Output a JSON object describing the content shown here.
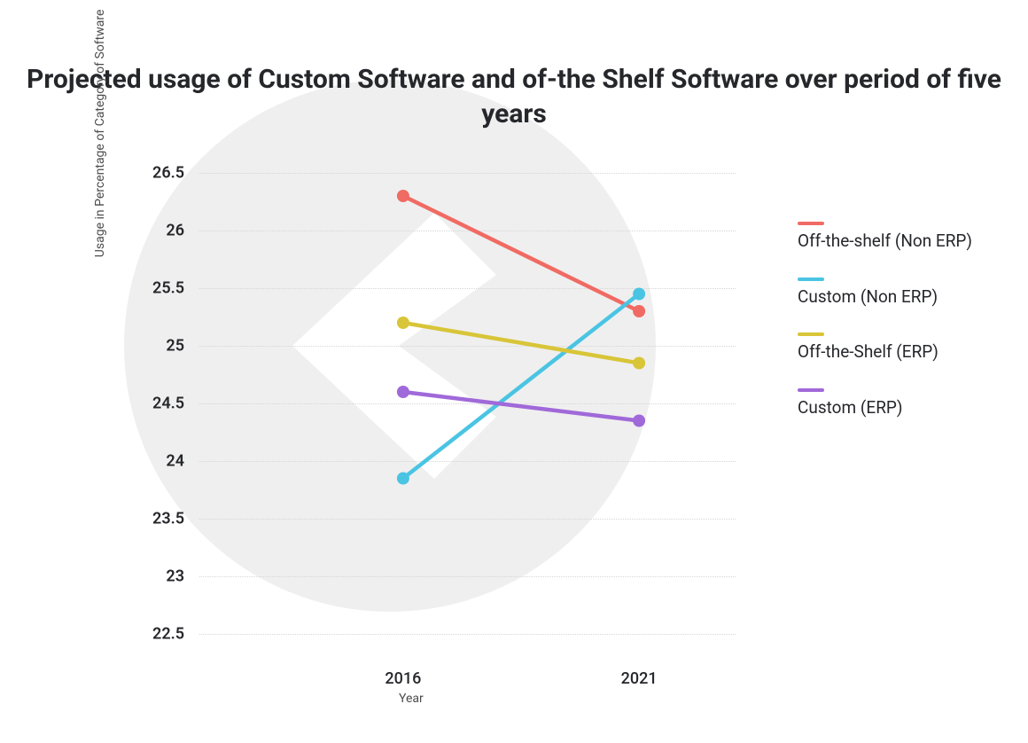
{
  "title": "Projected usage of Custom Software and of-the Shelf Software over period of five years",
  "xlabel": "Year",
  "ylabel": "Usage in Percentage of Category of Software",
  "chart_data": {
    "type": "line",
    "x": [
      "2016",
      "2021"
    ],
    "ylabel": "Usage in Percentage of Category of Software",
    "xlabel": "Year",
    "title": "Projected usage of Custom Software and of-the Shelf Software over period of five years",
    "ylim": [
      22.5,
      26.5
    ],
    "y_ticks": [
      22.5,
      23,
      23.5,
      24,
      24.5,
      25,
      25.5,
      26,
      26.5
    ],
    "legend_position": "right",
    "grid": true,
    "series": [
      {
        "name": "Off-the-shelf (Non ERP)",
        "color": "#f06b63",
        "values": [
          26.3,
          25.3
        ]
      },
      {
        "name": "Custom (Non ERP)",
        "color": "#4ac4e3",
        "values": [
          23.85,
          25.45
        ]
      },
      {
        "name": "Off-the-Shelf (ERP)",
        "color": "#d8c538",
        "values": [
          25.2,
          24.85
        ]
      },
      {
        "name": "Custom (ERP)",
        "color": "#a069d9",
        "values": [
          24.6,
          24.35
        ]
      }
    ]
  }
}
